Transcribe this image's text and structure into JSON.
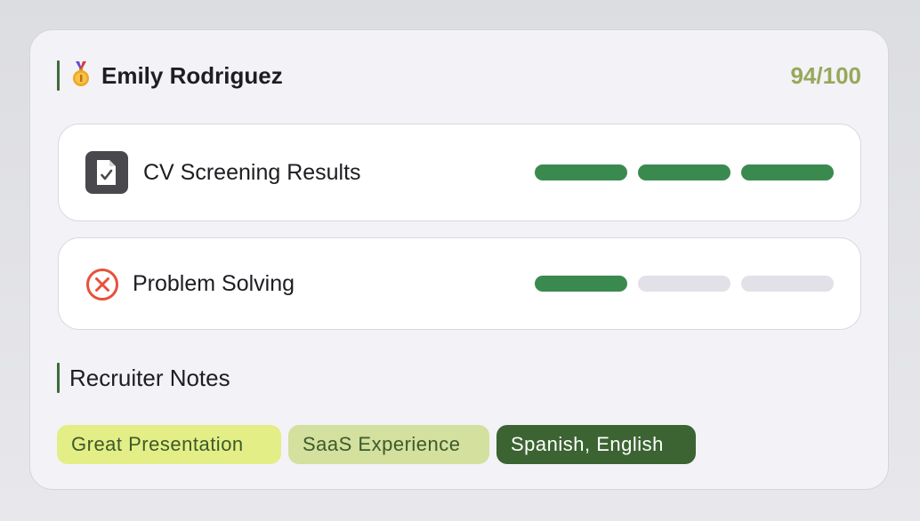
{
  "candidate": {
    "name": "Emily Rodriguez",
    "score": "94/100",
    "medal_icon": "gold-medal-icon"
  },
  "evaluations": [
    {
      "label": "CV Screening Results",
      "icon": "document-check-icon",
      "rating": 3,
      "max_rating": 3
    },
    {
      "label": "Problem Solving",
      "icon": "x-circle-icon",
      "rating": 1,
      "max_rating": 3
    }
  ],
  "notes": {
    "title": "Recruiter Notes",
    "tags": [
      "Great Presentation",
      "SaaS Experience",
      "Spanish, English"
    ]
  },
  "colors": {
    "accent": "#3d6b3a",
    "score": "#97a85a",
    "bar_filled": "#3a8a50",
    "bar_empty": "#e1e1e7",
    "x_icon": "#e8503a"
  }
}
